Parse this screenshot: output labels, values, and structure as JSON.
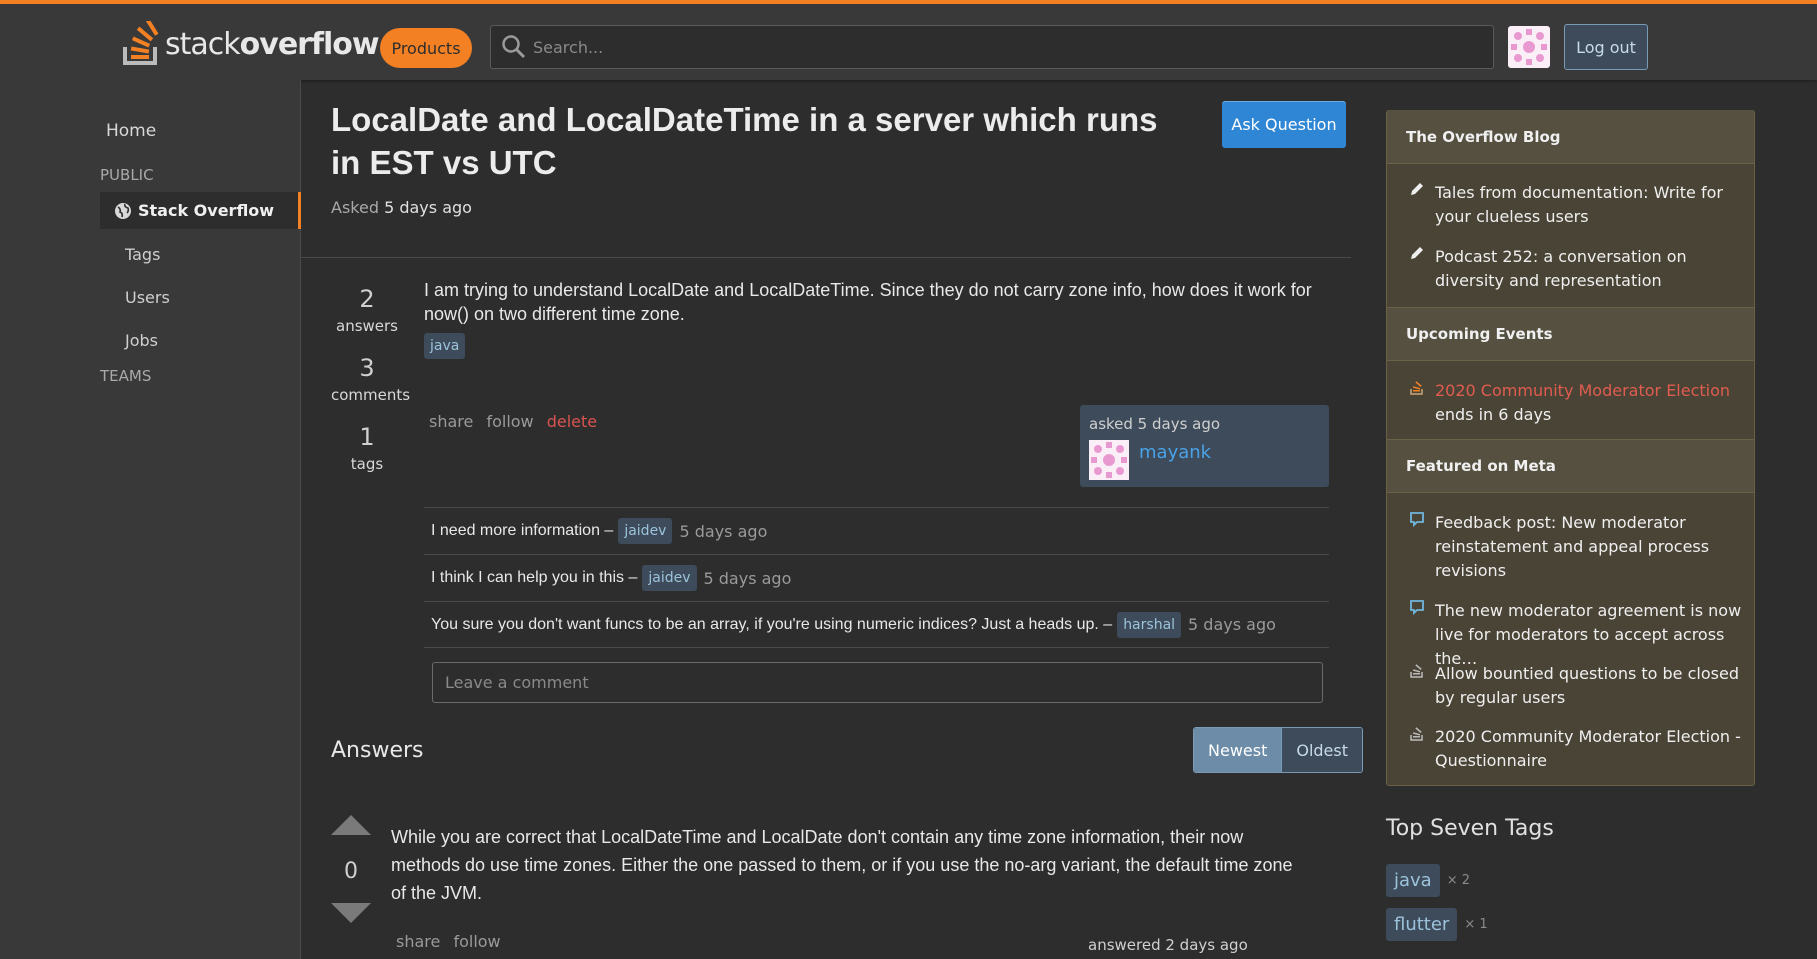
{
  "header": {
    "logo_light": "stack",
    "logo_bold": "overflow",
    "products_label": "Products",
    "search_placeholder": "Search...",
    "logout_label": "Log out"
  },
  "leftnav": {
    "home": "Home",
    "public_heading": "PUBLIC",
    "active_item": "Stack Overflow",
    "items": [
      "Tags",
      "Users",
      "Jobs"
    ],
    "teams_heading": "TEAMS"
  },
  "question": {
    "title": "LocalDate and LocalDateTime in a server which runs in EST vs UTC",
    "asked_label": "Asked",
    "asked_value": "5 days ago",
    "ask_button": "Ask Question",
    "stats": [
      {
        "num": "2",
        "label": "answers"
      },
      {
        "num": "3",
        "label": "comments"
      },
      {
        "num": "1",
        "label": "tags"
      }
    ],
    "body": "I am trying to understand LocalDate and LocalDateTime. Since they do not carry zone info, how does it work for now() on two different time zone.",
    "tags": [
      "java"
    ],
    "menu": {
      "share": "share",
      "follow": "follow",
      "delete": "delete"
    },
    "owner": {
      "when": "asked 5 days ago",
      "name": "mayank"
    },
    "comments": [
      {
        "text": "I need more information –",
        "user": "jaidev",
        "time": "5 days ago"
      },
      {
        "text": "I think I can help you in this –",
        "user": "jaidev",
        "time": "5 days ago"
      },
      {
        "text": "You sure you don't want funcs to be an array, if you're using numeric indices? Just a heads up. –",
        "user": "harshal",
        "time": "5 days ago"
      }
    ],
    "comment_placeholder": "Leave a comment"
  },
  "answers": {
    "heading": "Answers",
    "sort_newest": "Newest",
    "sort_oldest": "Oldest",
    "items": [
      {
        "score": "0",
        "body": "While you are correct that LocalDateTime and LocalDate don't contain any time zone information, their now methods do use time zones. Either the one passed to them, or if you use the no-arg variant, the default time zone of the JVM.",
        "share": "share",
        "follow": "follow",
        "when": "answered 2 days ago"
      }
    ]
  },
  "sidebar": {
    "blog_heading": "The Overflow Blog",
    "blog_items": [
      "Tales from documentation: Write for your clueless users",
      "Podcast 252: a conversation on diversity and representation"
    ],
    "events_heading": "Upcoming Events",
    "event_link": "2020 Community Moderator Election",
    "event_suffix": "ends in 6 days",
    "meta_heading": "Featured on Meta",
    "meta_items": [
      "Feedback post: New moderator reinstatement and appeal process revisions",
      "The new moderator agreement is now live for moderators to accept across the…",
      "Allow bountied questions to be closed by regular users",
      "2020 Community Moderator Election - Questionnaire"
    ],
    "top_tags_heading": "Top Seven Tags",
    "top_tags": [
      {
        "name": "java",
        "count": "× 2"
      },
      {
        "name": "flutter",
        "count": "× 1"
      }
    ]
  },
  "colors": {
    "accent": "#f48024",
    "link": "#4aa3e8",
    "primary_button": "#2f86d4",
    "danger": "#d9534f"
  }
}
